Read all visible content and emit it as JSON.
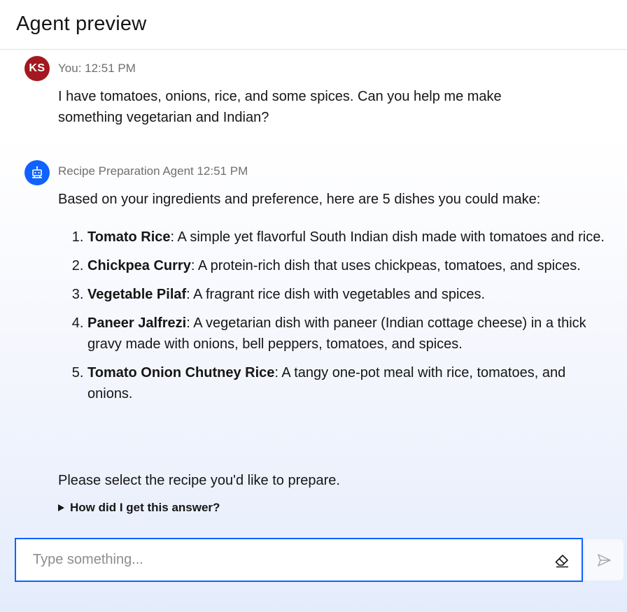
{
  "header": {
    "title": "Agent preview"
  },
  "user_message": {
    "avatar_initials": "KS",
    "meta": "You: 12:51 PM",
    "text_line1": "I have tomatoes, onions, rice, and some spices. Can you help me make",
    "text_line2": "something vegetarian and Indian?"
  },
  "agent_message": {
    "avatar_icon": "robot-icon",
    "meta": "Recipe Preparation Agent 12:51 PM",
    "intro": "Based on your ingredients and preference, here are 5 dishes you could make:",
    "recipes": [
      {
        "name": "Tomato Rice",
        "desc": ": A simple yet flavorful South Indian dish made with tomatoes and rice."
      },
      {
        "name": "Chickpea Curry",
        "desc": ": A protein-rich dish that uses chickpeas, tomatoes, and spices."
      },
      {
        "name": "Vegetable Pilaf",
        "desc": ": A fragrant rice dish with vegetables and spices."
      },
      {
        "name": "Paneer Jalfrezi",
        "desc": ": A vegetarian dish with paneer (Indian cottage cheese) in a thick gravy made with onions, bell peppers, tomatoes, and spices."
      },
      {
        "name": "Tomato Onion Chutney Rice",
        "desc": ": A tangy one-pot meal with rice, tomatoes, and onions."
      }
    ],
    "closing": "Please select the recipe you'd like to prepare.",
    "explain_label": "How did I get this answer?"
  },
  "composer": {
    "placeholder": "Type something...",
    "value": "",
    "clear_icon": "eraser-icon",
    "send_icon": "send-icon"
  },
  "colors": {
    "accent": "#0f62fe",
    "user_avatar": "#a2191f",
    "meta_text": "#6f6f6f"
  }
}
